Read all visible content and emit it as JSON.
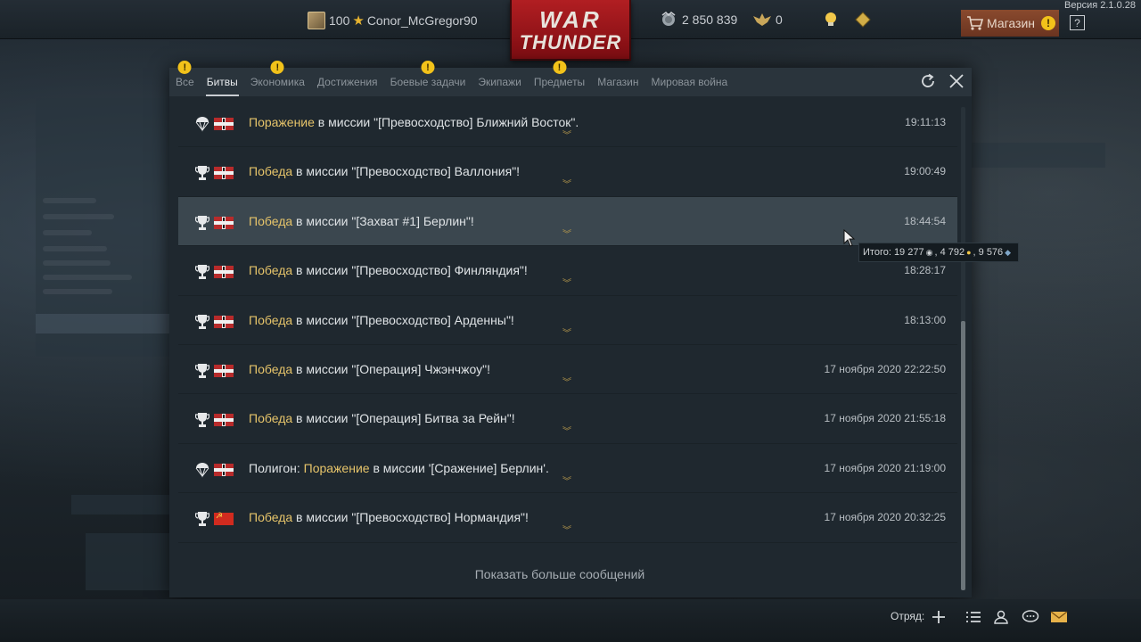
{
  "version": "Версия 2.1.0.28",
  "topbar": {
    "rank": "100",
    "username": "Conor_McGregor90",
    "logo_line1": "WAR",
    "logo_line2": "THUNDER",
    "silver_lions": "2 850 839",
    "golden_eagles": "0",
    "shop_label": "Магазин",
    "help_label": "?"
  },
  "dialog": {
    "tabs": [
      {
        "label": "Все",
        "warning": true
      },
      {
        "label": "Битвы",
        "warning": false,
        "active": true
      },
      {
        "label": "Экономика",
        "warning": true
      },
      {
        "label": "Достижения",
        "warning": false
      },
      {
        "label": "Боевые задачи",
        "warning": true
      },
      {
        "label": "Экипажи",
        "warning": false
      },
      {
        "label": "Предметы",
        "warning": true
      },
      {
        "label": "Магазин",
        "warning": false
      },
      {
        "label": "Мировая война",
        "warning": false
      }
    ],
    "messages": [
      {
        "prefix": "",
        "result": "Поражение",
        "text": " в миссии \"[Превосходство] Ближний Восток\".",
        "time": "19:11:13",
        "icon": "parachute-icon",
        "flag": "de"
      },
      {
        "prefix": "",
        "result": "Победа",
        "text": " в миссии \"[Превосходство] Валлония\"!",
        "time": "19:00:49",
        "icon": "trophy-icon",
        "flag": "de"
      },
      {
        "prefix": "",
        "result": "Победа",
        "text": " в миссии \"[Захват #1] Берлин\"!",
        "time": "18:44:54",
        "icon": "trophy-icon",
        "flag": "de",
        "selected": true
      },
      {
        "prefix": "",
        "result": "Победа",
        "text": " в миссии \"[Превосходство] Финляндия\"!",
        "time": "18:28:17",
        "icon": "trophy-icon",
        "flag": "de"
      },
      {
        "prefix": "",
        "result": "Победа",
        "text": " в миссии \"[Превосходство] Арденны\"!",
        "time": "18:13:00",
        "icon": "trophy-icon",
        "flag": "de"
      },
      {
        "prefix": "",
        "result": "Победа",
        "text": " в миссии \"[Операция] Чжэнчжоу\"!",
        "time": "17 ноября 2020 22:22:50",
        "icon": "trophy-icon",
        "flag": "de"
      },
      {
        "prefix": "",
        "result": "Победа",
        "text": " в миссии \"[Операция] Битва за Рейн\"!",
        "time": "17 ноября 2020 21:55:18",
        "icon": "trophy-icon",
        "flag": "de"
      },
      {
        "prefix": "Полигон: ",
        "result": "Поражение",
        "text": " в миссии '[Сражение] Берлин'.",
        "time": "17 ноября 2020 21:19:00",
        "icon": "parachute-icon",
        "flag": "de"
      },
      {
        "prefix": "",
        "result": "Победа",
        "text": " в миссии \"[Превосходство] Нормандия\"!",
        "time": "17 ноября 2020 20:32:25",
        "icon": "trophy-icon",
        "flag": "su"
      }
    ],
    "show_more": "Показать больше сообщений",
    "tooltip": {
      "label": "Итого: 19 277",
      "rp": ", 4 792",
      "crp": ", 9 576"
    }
  },
  "bottombar": {
    "squad_label": "Отряд:"
  },
  "colors": {
    "result_accent": "#e6c46a",
    "shop_button": "#8a4a2e",
    "warning": "#f2c21a",
    "logo_red": "#b11e22"
  }
}
